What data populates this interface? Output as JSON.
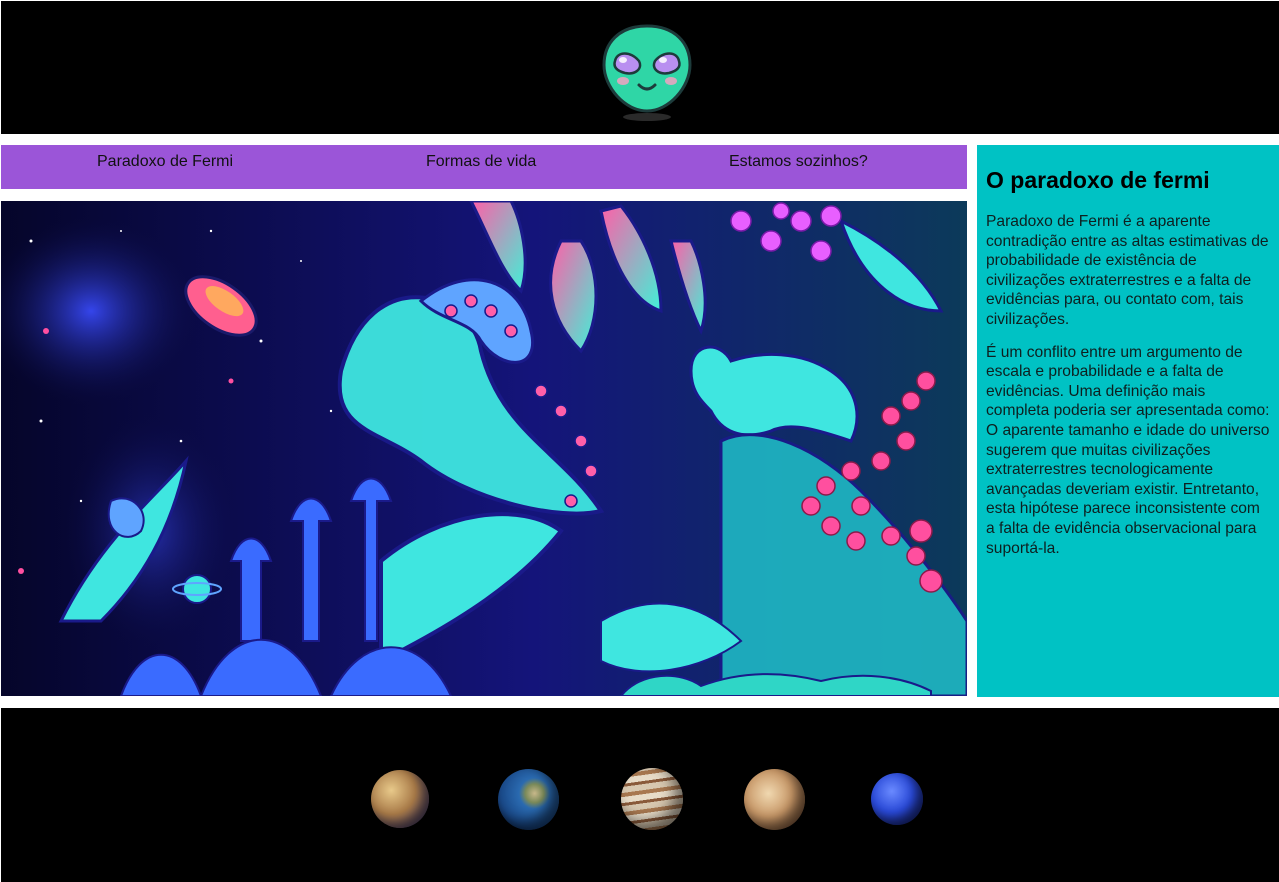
{
  "header": {
    "logo_icon": "alien-face-icon",
    "logo_color": "#2fd6a6"
  },
  "nav": {
    "items": [
      {
        "label": "Paradoxo de Fermi"
      },
      {
        "label": "Formas de vida"
      },
      {
        "label": "Estamos sozinhos?"
      }
    ],
    "background": "#9b55d8"
  },
  "main": {
    "image_icon": "psychedelic-alien-artwork-image"
  },
  "aside": {
    "title": "O paradoxo de fermi",
    "paragraphs": [
      "Paradoxo de Fermi é a aparente contradição entre as altas estimativas de probabilidade de existência de civilizações extraterrestres e a falta de evidências para, ou contato com, tais civilizações.",
      "É um conflito entre um argumento de escala e probabilidade e a falta de evidências. Uma definição mais completa poderia ser apresentada como: O aparente tamanho e idade do universo sugerem que muitas civilizações extraterrestres tecnologicamente avançadas deveriam existir. Entretanto, esta hipótese parece inconsistente com a falta de evidência observacional para suportá-la."
    ],
    "background": "#00c2c4"
  },
  "footer": {
    "planets": [
      {
        "icon": "mercury-planet-icon"
      },
      {
        "icon": "earth-planet-icon"
      },
      {
        "icon": "jupiter-planet-icon"
      },
      {
        "icon": "europa-moon-icon"
      },
      {
        "icon": "neptune-planet-icon"
      }
    ]
  }
}
